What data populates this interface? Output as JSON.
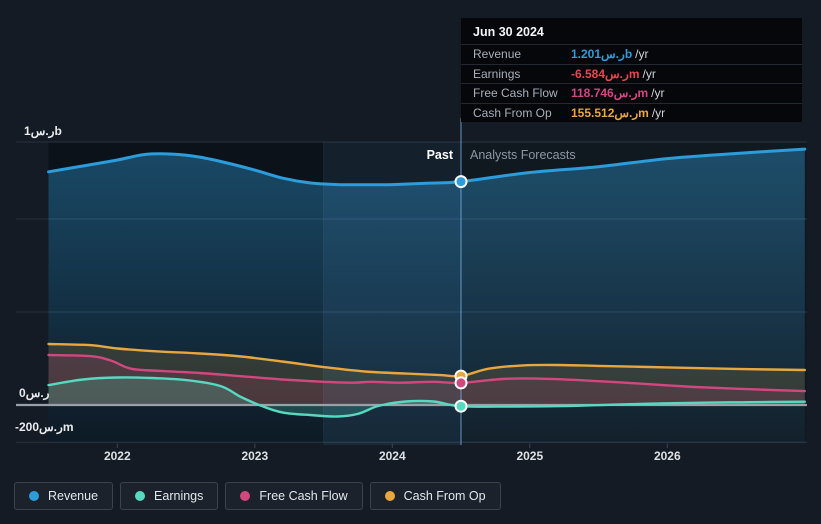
{
  "page": {
    "bg": "#151b24"
  },
  "tooltip": {
    "title": "Jun 30 2024",
    "rows": [
      {
        "label": "Revenue",
        "value": "1.201ر.سb",
        "unit": "/yr",
        "color": "#2d9cdb"
      },
      {
        "label": "Earnings",
        "value": "-6.584ر.سm",
        "unit": "/yr",
        "color": "#e5484d"
      },
      {
        "label": "Free Cash Flow",
        "value": "118.746ر.سm",
        "unit": "/yr",
        "color": "#d2477e"
      },
      {
        "label": "Cash From Op",
        "value": "155.512ر.سm",
        "unit": "/yr",
        "color": "#e8a63e"
      }
    ]
  },
  "annotations": {
    "past": "Past",
    "forecast": "Analysts Forecasts"
  },
  "axes": {
    "y": [
      {
        "text": "1ر.سb",
        "value_m": 1000
      },
      {
        "text": "0ر.س",
        "value_m": 0
      },
      {
        "text": "-200ر.سm",
        "value_m": -200
      }
    ],
    "x": [
      "2022",
      "2023",
      "2024",
      "2025",
      "2026"
    ]
  },
  "legend": {
    "items": [
      {
        "label": "Revenue",
        "color": "#2d9cdb"
      },
      {
        "label": "Earnings",
        "color": "#57d9c1"
      },
      {
        "label": "Free Cash Flow",
        "color": "#d2477e"
      },
      {
        "label": "Cash From Op",
        "color": "#e8a63e"
      }
    ]
  },
  "chart_data": {
    "type": "line",
    "title": "",
    "xlabel": "",
    "ylabel": "SAR",
    "y_unit": "SAR millions per year",
    "x_unit": "calendar year",
    "x_range": [
      2021.5,
      2027.0
    ],
    "ylim_m": [
      -260,
      1420
    ],
    "x_ticks": [
      2022,
      2023,
      2024,
      2025,
      2026
    ],
    "y_gridlines_m": [
      1000,
      500,
      0,
      -200
    ],
    "divider_t": 2024.5,
    "divider_date": "Jun 30 2024",
    "highlight_band_t": [
      2023.5,
      2024.5
    ],
    "legend_position": "bottom-left",
    "grid": true,
    "series": [
      {
        "name": "Revenue",
        "color": "#2d9cdb",
        "points": [
          [
            2021.5,
            1254
          ],
          [
            2021.75,
            1285
          ],
          [
            2022.0,
            1317
          ],
          [
            2022.2,
            1347
          ],
          [
            2022.4,
            1349
          ],
          [
            2022.6,
            1333
          ],
          [
            2022.8,
            1301
          ],
          [
            2023.0,
            1263
          ],
          [
            2023.2,
            1220
          ],
          [
            2023.4,
            1194
          ],
          [
            2023.6,
            1185
          ],
          [
            2023.8,
            1184
          ],
          [
            2024.0,
            1185
          ],
          [
            2024.25,
            1192
          ],
          [
            2024.5,
            1201
          ],
          [
            2025.0,
            1250
          ],
          [
            2025.5,
            1281
          ],
          [
            2026.0,
            1325
          ],
          [
            2026.5,
            1352
          ],
          [
            2027.0,
            1376
          ]
        ]
      },
      {
        "name": "Cash From Op",
        "color": "#e8a63e",
        "points": [
          [
            2021.5,
            328
          ],
          [
            2021.8,
            322
          ],
          [
            2022.0,
            304
          ],
          [
            2022.3,
            288
          ],
          [
            2022.6,
            277
          ],
          [
            2022.9,
            261
          ],
          [
            2023.2,
            234
          ],
          [
            2023.5,
            204
          ],
          [
            2023.8,
            180
          ],
          [
            2024.1,
            169
          ],
          [
            2024.35,
            161
          ],
          [
            2024.5,
            155.512
          ],
          [
            2024.7,
            195
          ],
          [
            2024.95,
            213
          ],
          [
            2025.2,
            215
          ],
          [
            2025.5,
            210
          ],
          [
            2026.0,
            202
          ],
          [
            2026.5,
            194
          ],
          [
            2027.0,
            188
          ]
        ]
      },
      {
        "name": "Free Cash Flow",
        "color": "#d2477e",
        "points": [
          [
            2021.5,
            269
          ],
          [
            2021.8,
            263
          ],
          [
            2021.95,
            240
          ],
          [
            2022.1,
            195
          ],
          [
            2022.3,
            184
          ],
          [
            2022.6,
            172
          ],
          [
            2022.9,
            155
          ],
          [
            2023.2,
            137
          ],
          [
            2023.5,
            125
          ],
          [
            2023.7,
            120
          ],
          [
            2023.85,
            125
          ],
          [
            2024.05,
            120
          ],
          [
            2024.3,
            125
          ],
          [
            2024.5,
            118.746
          ],
          [
            2024.8,
            140
          ],
          [
            2025.05,
            142
          ],
          [
            2025.4,
            132
          ],
          [
            2025.8,
            115
          ],
          [
            2026.2,
            97
          ],
          [
            2026.6,
            85
          ],
          [
            2027.0,
            75
          ]
        ]
      },
      {
        "name": "Earnings",
        "color": "#57d9c1",
        "points": [
          [
            2021.5,
            107
          ],
          [
            2021.75,
            137
          ],
          [
            2022.0,
            148
          ],
          [
            2022.25,
            145
          ],
          [
            2022.5,
            134
          ],
          [
            2022.75,
            102
          ],
          [
            2022.9,
            43
          ],
          [
            2023.05,
            -5
          ],
          [
            2023.2,
            -40
          ],
          [
            2023.4,
            -54
          ],
          [
            2023.6,
            -62
          ],
          [
            2023.75,
            -48
          ],
          [
            2023.9,
            -5
          ],
          [
            2024.1,
            19
          ],
          [
            2024.3,
            19
          ],
          [
            2024.5,
            -6.584
          ],
          [
            2024.9,
            -8
          ],
          [
            2025.3,
            -5
          ],
          [
            2025.7,
            4
          ],
          [
            2026.2,
            12
          ],
          [
            2026.6,
            15
          ],
          [
            2027.0,
            18
          ]
        ]
      }
    ]
  }
}
